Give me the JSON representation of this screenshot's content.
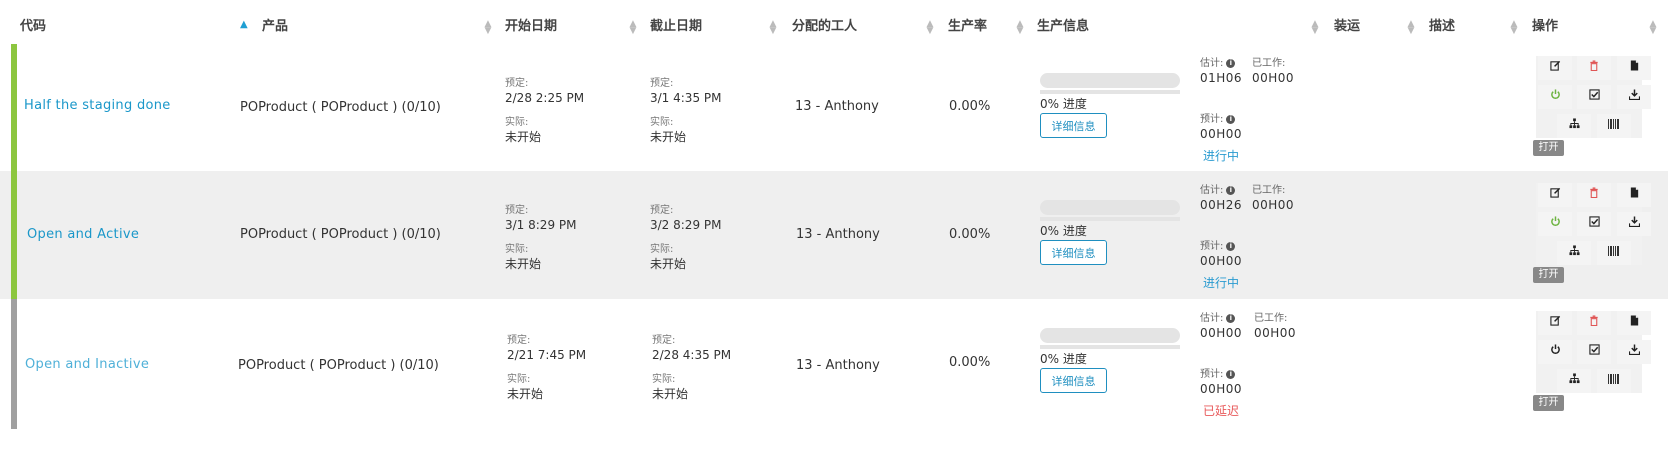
{
  "header": {
    "code": "代码",
    "product": "产品",
    "start_date": "开始日期",
    "end_date": "截止日期",
    "worker": "分配的工人",
    "rate": "生产率",
    "production_info": "生产信息",
    "shipping": "装运",
    "description": "描述",
    "actions": "操作"
  },
  "labels": {
    "scheduled": "预定:",
    "actual": "实际:",
    "estimate": "估计:",
    "worked": "已工作:",
    "expected": "预计:",
    "progress_suffix": "进度",
    "details_button": "详细信息",
    "open_badge": "打开",
    "info_icon": "i"
  },
  "rows": [
    {
      "code": "Half the staging done",
      "product": "POProduct ( POProduct ) (0/10)",
      "start_sched": "2/28   2:25 PM",
      "start_actual": "未开始",
      "end_sched": "3/1   4:35 PM",
      "end_actual": "未开始",
      "worker": "13 - Anthony",
      "rate": "0.00%",
      "progress": "0%",
      "estimate": "01H06",
      "worked": "00H00",
      "expected": "00H00",
      "status": "进行中",
      "status_color": "#2a9bd0",
      "bar_color": "#8cc63f",
      "power_color": "#6cb33f"
    },
    {
      "code": "Open and Active",
      "product": "POProduct ( POProduct ) (0/10)",
      "start_sched": "3/1   8:29 PM",
      "start_actual": "未开始",
      "end_sched": "3/2   8:29 PM",
      "end_actual": "未开始",
      "worker": "13 - Anthony",
      "rate": "0.00%",
      "progress": "0%",
      "estimate": "00H26",
      "worked": "00H00",
      "expected": "00H00",
      "status": "进行中",
      "status_color": "#2a9bd0",
      "bar_color": "#8cc63f",
      "power_color": "#6cb33f"
    },
    {
      "code": "Open and Inactive",
      "product": "POProduct ( POProduct ) (0/10)",
      "start_sched": "2/21   7:45 PM",
      "start_actual": "未开始",
      "end_sched": "2/28   4:35 PM",
      "end_actual": "未开始",
      "worker": "13 - Anthony",
      "rate": "0.00%",
      "progress": "0%",
      "estimate": "00H00",
      "worked": "00H00",
      "expected": "00H00",
      "status": "已延迟",
      "status_color": "#e8595a",
      "bar_color": "#a0a0a0",
      "power_color": "#222222"
    }
  ],
  "icons": [
    "edit-icon",
    "trash-icon",
    "file-icon",
    "power-icon",
    "check-icon",
    "download-icon",
    "hierarchy-icon",
    "barcode-icon"
  ]
}
